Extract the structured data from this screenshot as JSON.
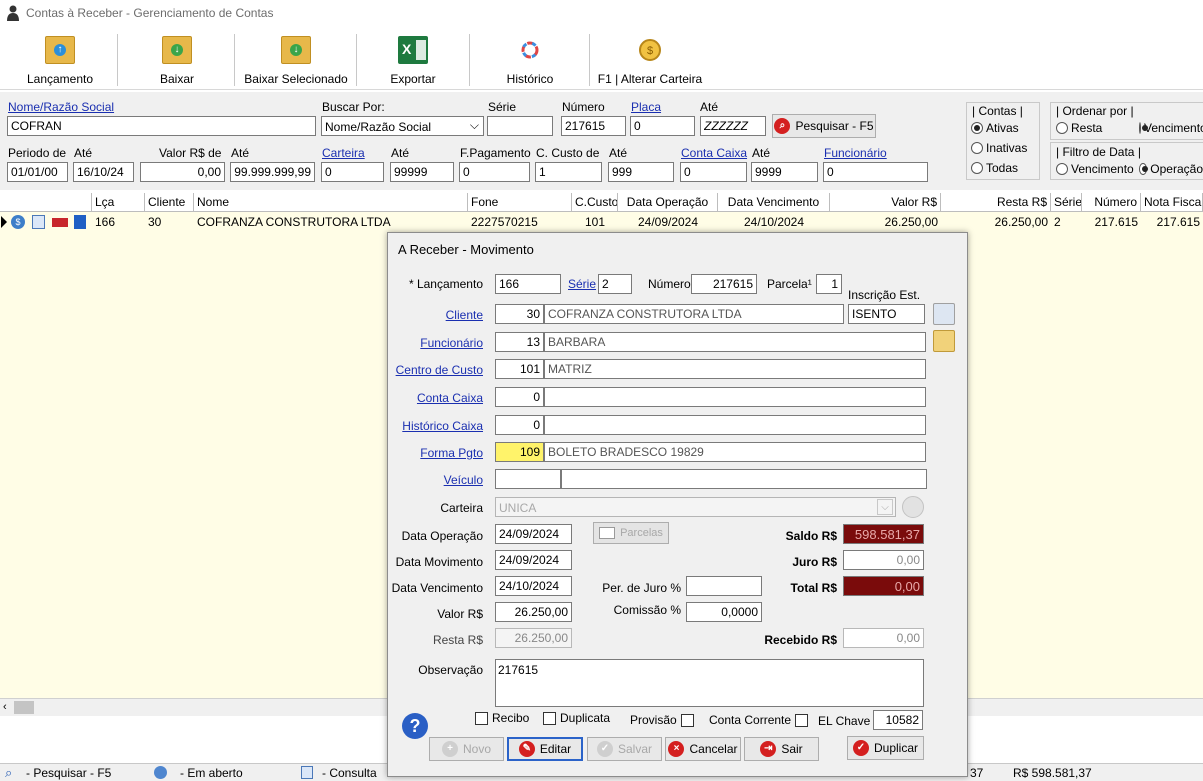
{
  "window": {
    "title": "Contas à Receber - Gerenciamento de Contas"
  },
  "toolbar": {
    "lancamento": "Lançamento",
    "baixar": "Baixar",
    "baixar_selecionado": "Baixar Selecionado",
    "exportar": "Exportar",
    "historico": "Histórico",
    "alterar_carteira": "F1 | Alterar Carteira"
  },
  "filters": {
    "nome_label": "Nome/Razão Social",
    "nome_value": "COFRAN",
    "buscar_label": "Buscar Por:",
    "buscar_value": "Nome/Razão Social",
    "serie_label": "Série",
    "serie_value": "",
    "numero_label": "Número",
    "numero_value": "217615",
    "placa_label": "Placa",
    "placa_value": "0",
    "ate_placa_label": "Até",
    "ate_placa_value": "ZZZZZZ",
    "pesquisar": "Pesquisar - F5",
    "periodo_label": "Periodo de",
    "periodo_value": "01/01/00",
    "ate_periodo_label": "Até",
    "ate_periodo_value": "16/10/24",
    "valor_label": "Valor R$ de",
    "valor_value": "0,00",
    "ate_valor_label": "Até",
    "ate_valor_value": "99.999.999,99",
    "carteira_label": "Carteira",
    "carteira_value": "0",
    "ate_carteira_label": "Até",
    "ate_carteira_value": "99999",
    "fpag_label": "F.Pagamento",
    "fpag_value": "0",
    "ccusto_label": "C. Custo de",
    "ccusto_value": "1",
    "ate_ccusto_label": "Até",
    "ate_ccusto_value": "999",
    "contacaixa_label": "Conta Caixa",
    "contacaixa_value": "0",
    "ate_contacaixa_label": "Até",
    "ate_contacaixa_value": "9999",
    "funcionario_label": "Funcionário",
    "funcionario_value": "0",
    "contas_group": "| Contas |",
    "contas_ativas": "Ativas",
    "contas_inativas": "Inativas",
    "contas_todas": "Todas",
    "ordenar_group": "| Ordenar por |",
    "ordenar_resta": "Resta",
    "ordenar_venc": "Vencimento",
    "filtro_group": "| Filtro de Data |",
    "filtro_venc": "Vencimento",
    "filtro_oper": "Operação"
  },
  "grid": {
    "headers": [
      "Lça",
      "Cliente",
      "Nome",
      "Fone",
      "C.Custo",
      "Data Operação",
      "Data Vencimento",
      "Valor R$",
      "Resta R$",
      "Série",
      "Número",
      "Nota Fiscal"
    ],
    "row": [
      "166",
      "30",
      "COFRANZA CONSTRUTORA LTDA",
      "2227570215",
      "101",
      "24/09/2024",
      "24/10/2024",
      "26.250,00",
      "26.250,00",
      "2",
      "217.615",
      "217.615"
    ]
  },
  "status": {
    "pesquisar": "- Pesquisar - F5",
    "aberto": "- Em aberto",
    "consulta": "- Consulta",
    "count": "37",
    "total": "R$ 598.581,37"
  },
  "dialog": {
    "title": "A Receber - Movimento",
    "lancamento_label": "* Lançamento",
    "lancamento_value": "166",
    "serie_label": "Série",
    "serie_value": "2",
    "numero_label": "Número",
    "numero_value": "217615",
    "parcela_label": "Parcela¹",
    "parcela_value": "1",
    "inscricao_label": "Inscrição Est.",
    "inscricao_value": "ISENTO",
    "cliente_label": "Cliente",
    "cliente_code": "30",
    "cliente_name": "COFRANZA CONSTRUTORA LTDA",
    "funcionario_label": "Funcionário",
    "funcionario_code": "13",
    "funcionario_name": "BARBARA",
    "ccusto_label": "Centro de Custo",
    "ccusto_code": "101",
    "ccusto_name": "MATRIZ",
    "contacaixa_label": "Conta Caixa",
    "contacaixa_code": "0",
    "contacaixa_name": "",
    "historico_label": "Histórico Caixa",
    "historico_code": "0",
    "historico_name": "",
    "forma_label": "Forma Pgto",
    "forma_code": "109",
    "forma_name": "BOLETO BRADESCO 19829",
    "veiculo_label": "Veículo",
    "veiculo_code": "",
    "veiculo_name": "",
    "carteira_label": "Carteira",
    "carteira_value": "UNICA",
    "data_oper_label": "Data Operação",
    "data_oper_value": "24/09/2024",
    "data_mov_label": "Data Movimento",
    "data_mov_value": "24/09/2024",
    "data_venc_label": "Data Vencimento",
    "data_venc_value": "24/10/2024",
    "valor_label": "Valor R$",
    "valor_value": "26.250,00",
    "resta_label": "Resta R$",
    "resta_value": "26.250,00",
    "parcelas_btn": "Parcelas",
    "perjuro_label": "Per. de Juro %",
    "perjuro_value": "",
    "comissao_label": "Comissão %",
    "comissao_value": "0,0000",
    "saldo_label": "Saldo R$",
    "saldo_value": "598.581,37",
    "juro_label": "Juro R$",
    "juro_value": "0,00",
    "total_label": "Total R$",
    "total_value": "0,00",
    "recebido_label": "Recebido R$",
    "recebido_value": "0,00",
    "obs_label": "Observação",
    "obs_value": "217615",
    "recibo": "Recibo",
    "duplicata": "Duplicata",
    "provisao": "Provisão",
    "conta_corrente": "Conta Corrente",
    "elchave_label": "EL Chave",
    "elchave_value": "10582",
    "btn_novo": "Novo",
    "btn_editar": "Editar",
    "btn_salvar": "Salvar",
    "btn_cancelar": "Cancelar",
    "btn_sair": "Sair",
    "btn_duplicar": "Duplicar"
  },
  "colors": {
    "saldo_bg": "#7a0b0b",
    "forma_code_bg": "#fff36a",
    "link": "#1a2fb0",
    "grid_bg": "#fffde6"
  }
}
